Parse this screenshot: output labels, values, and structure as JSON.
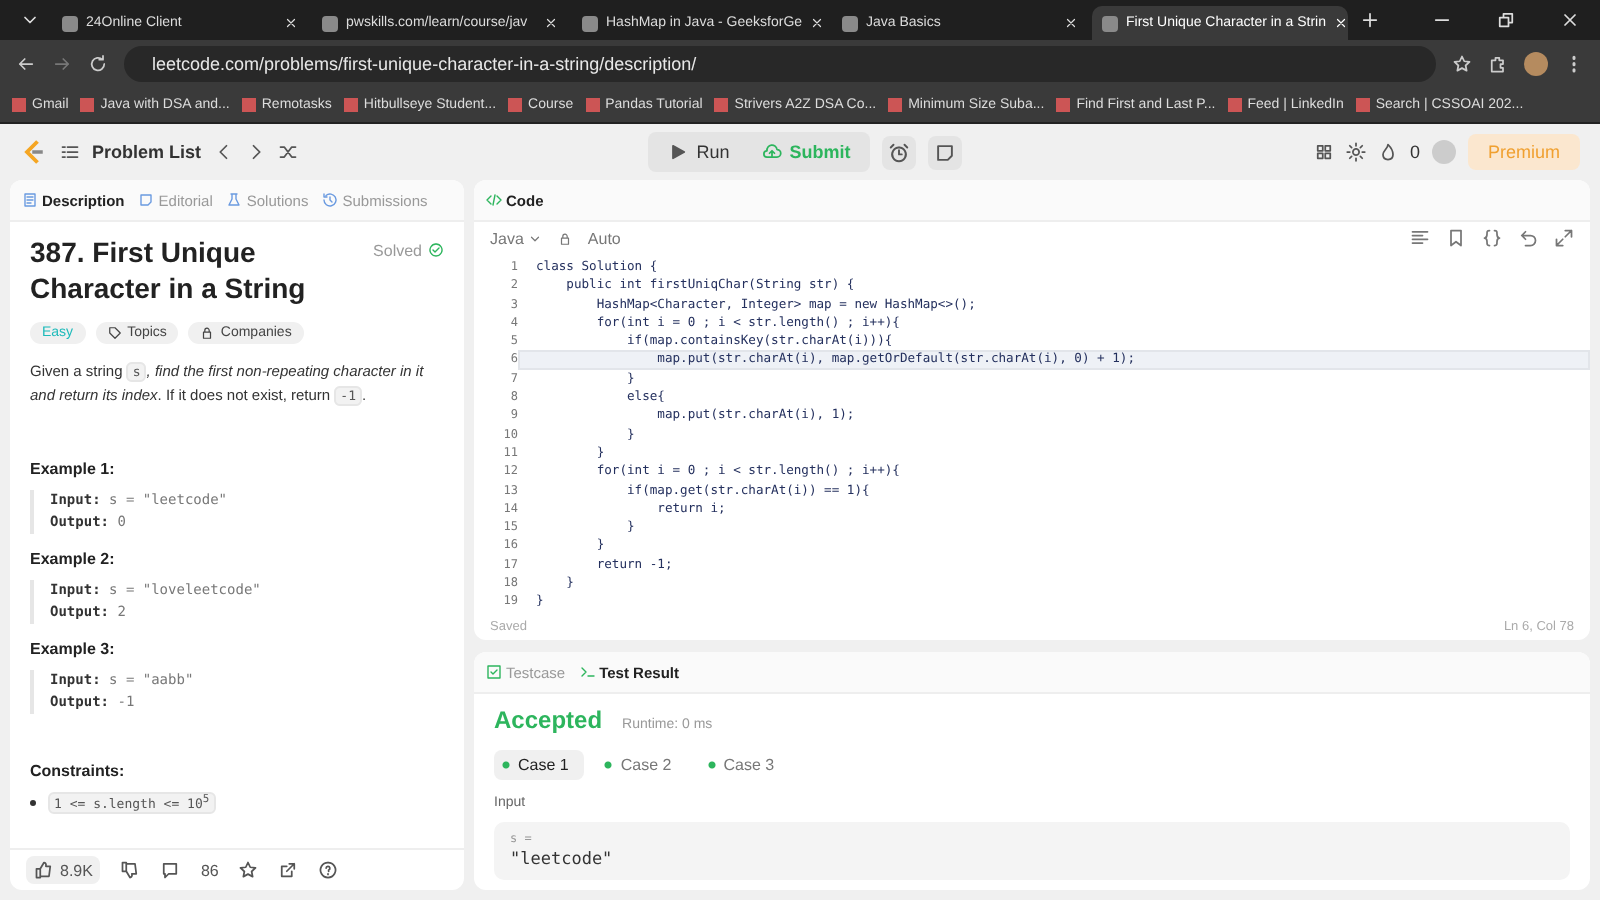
{
  "browser": {
    "tabs": [
      {
        "title": "24Online Client",
        "selected": false
      },
      {
        "title": "pwskills.com/learn/course/jav",
        "selected": false
      },
      {
        "title": "HashMap in Java - GeeksforGe",
        "selected": false
      },
      {
        "title": "Java Basics",
        "selected": false
      },
      {
        "title": "First Unique Character in a Strin",
        "selected": true
      }
    ],
    "url": "leetcode.com/problems/first-unique-character-in-a-string/description/",
    "bookmarks": [
      "Gmail",
      "Java with DSA and...",
      "Remotasks",
      "Hitbullseye Student...",
      "Course",
      "Pandas Tutorial",
      "Strivers A2Z DSA Co...",
      "Minimum Size Suba...",
      "Find First and Last P...",
      "Feed | LinkedIn",
      "Search | CSSOAI 202..."
    ]
  },
  "nav": {
    "problem_list": "Problem List",
    "run": "Run",
    "submit": "Submit",
    "streak": "0",
    "premium": "Premium"
  },
  "description_tabs": [
    {
      "label": "Description",
      "selected": true
    },
    {
      "label": "Editorial",
      "selected": false
    },
    {
      "label": "Solutions",
      "selected": false
    },
    {
      "label": "Submissions",
      "selected": false
    }
  ],
  "problem": {
    "title": "387. First Unique Character in a String",
    "status": "Solved",
    "difficulty": "Easy",
    "tags": [
      "Topics",
      "Companies"
    ],
    "statement": [
      {
        "kind": "text",
        "text": "Given a string "
      },
      {
        "kind": "code",
        "text": "s"
      },
      {
        "kind": "italic",
        "text": ", find the first non-repeating character in it and return its index"
      },
      {
        "kind": "text",
        "text": ". If it does not exist, return "
      },
      {
        "kind": "code",
        "text": "-1"
      },
      {
        "kind": "text",
        "text": "."
      }
    ],
    "examples": [
      {
        "title": "Example 1:",
        "input_label": "Input:",
        "input": "s = \"leetcode\"",
        "output_label": "Output:",
        "output": "0"
      },
      {
        "title": "Example 2:",
        "input_label": "Input:",
        "input": "s = \"loveleetcode\"",
        "output_label": "Output:",
        "output": "2"
      },
      {
        "title": "Example 3:",
        "input_label": "Input:",
        "input": "s = \"aabb\"",
        "output_label": "Output:",
        "output": "-1"
      }
    ],
    "constraints_title": "Constraints:",
    "constraints": [
      "1 <= s.length <= 10$^{5}$"
    ],
    "likes": "8.9K",
    "comments": "86"
  },
  "editor": {
    "tab": "Code",
    "language": "Java",
    "mode": "Auto",
    "lines": [
      {
        "n": "1",
        "code": "class Solution {",
        "current": false
      },
      {
        "n": "2",
        "code": "    public int firstUniqChar(String str) {",
        "current": false
      },
      {
        "n": "3",
        "code": "        HashMap<Character, Integer> map = new HashMap<>();",
        "current": false
      },
      {
        "n": "4",
        "code": "        for(int i = 0 ; i < str.length() ; i++){",
        "current": false
      },
      {
        "n": "5",
        "code": "            if(map.containsKey(str.charAt(i))){",
        "current": false
      },
      {
        "n": "6",
        "code": "                map.put(str.charAt(i), map.getOrDefault(str.charAt(i), 0) + 1);",
        "current": true
      },
      {
        "n": "7",
        "code": "            }",
        "current": false
      },
      {
        "n": "8",
        "code": "            else{",
        "current": false
      },
      {
        "n": "9",
        "code": "                map.put(str.charAt(i), 1);",
        "current": false
      },
      {
        "n": "10",
        "code": "            }",
        "current": false
      },
      {
        "n": "11",
        "code": "        }",
        "current": false
      },
      {
        "n": "12",
        "code": "        for(int i = 0 ; i < str.length() ; i++){",
        "current": false
      },
      {
        "n": "13",
        "code": "            if(map.get(str.charAt(i)) == 1){",
        "current": false
      },
      {
        "n": "14",
        "code": "                return i;",
        "current": false
      },
      {
        "n": "15",
        "code": "            }",
        "current": false
      },
      {
        "n": "16",
        "code": "        }",
        "current": false
      },
      {
        "n": "17",
        "code": "        return -1;",
        "current": false
      },
      {
        "n": "18",
        "code": "    }",
        "current": false
      },
      {
        "n": "19",
        "code": "}",
        "current": false
      }
    ],
    "saved": "Saved",
    "cursor": "Ln 6, Col 78"
  },
  "test": {
    "tabs": [
      {
        "label": "Testcase",
        "selected": false
      },
      {
        "label": "Test Result",
        "selected": true
      }
    ],
    "verdict": "Accepted",
    "runtime": "Runtime: 0 ms",
    "cases": [
      {
        "label": "Case 1",
        "selected": true
      },
      {
        "label": "Case 2",
        "selected": false
      },
      {
        "label": "Case 3",
        "selected": false
      }
    ],
    "input_label": "Input",
    "variable": "s =",
    "value": "\"leetcode\""
  }
}
